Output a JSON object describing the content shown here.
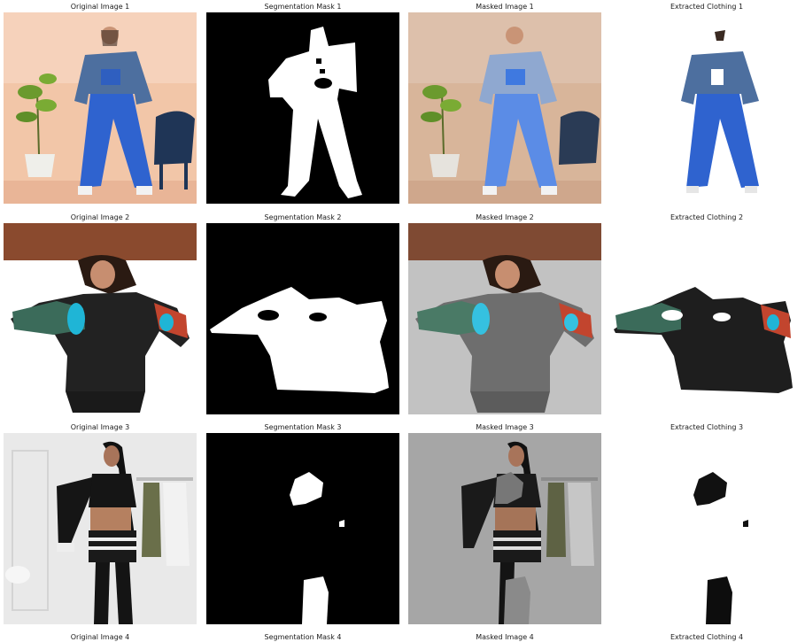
{
  "figure": {
    "rows": [
      {
        "titles": [
          "Original Image 1",
          "Segmentation Mask 1",
          "Masked Image 1",
          "Extracted Clothing 1"
        ]
      },
      {
        "titles": [
          "Original Image 2",
          "Segmentation Mask 2",
          "Masked Image 2",
          "Extracted Clothing 2"
        ]
      },
      {
        "titles": [
          "Original Image 3",
          "Segmentation Mask 3",
          "Masked Image 3",
          "Extracted Clothing 3"
        ]
      },
      {
        "titles": [
          "Original Image 4",
          "Segmentation Mask 4",
          "Masked Image 4",
          "Extracted Clothing 4"
        ]
      }
    ]
  },
  "colors": {
    "mask_background": "#000000",
    "mask_foreground": "#ffffff",
    "denim_light": "#3f6fd6",
    "denim_jacket": "#4a6e9e",
    "wall_peach": "#f1c3a4",
    "brown_band": "#8a4a2e",
    "masked_gray": "#bcbcbc",
    "floral_teal": "#1fb5d6"
  }
}
